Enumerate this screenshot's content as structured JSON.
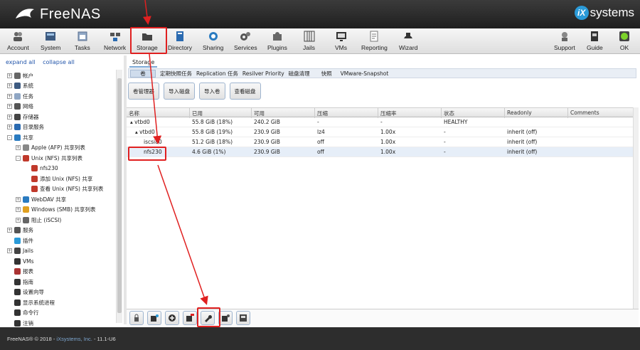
{
  "header": {
    "brand": "FreeNAS",
    "vendor_badge": "iX",
    "vendor": "systems"
  },
  "toolbar": {
    "items": [
      {
        "label": "Account",
        "icon": "users-icon"
      },
      {
        "label": "System",
        "icon": "system-icon"
      },
      {
        "label": "Tasks",
        "icon": "calendar-icon"
      },
      {
        "label": "Network",
        "icon": "network-icon"
      },
      {
        "label": "Storage",
        "icon": "folder-icon"
      },
      {
        "label": "Directory",
        "icon": "book-icon"
      },
      {
        "label": "Sharing",
        "icon": "share-icon"
      },
      {
        "label": "Services",
        "icon": "gears-icon"
      },
      {
        "label": "Plugins",
        "icon": "puzzle-icon"
      },
      {
        "label": "Jails",
        "icon": "jail-icon"
      },
      {
        "label": "VMs",
        "icon": "monitor-icon"
      },
      {
        "label": "Reporting",
        "icon": "report-icon"
      },
      {
        "label": "Wizard",
        "icon": "hat-icon"
      }
    ],
    "right_items": [
      {
        "label": "Support",
        "icon": "support-icon"
      },
      {
        "label": "Guide",
        "icon": "guide-icon"
      },
      {
        "label": "OK",
        "icon": "ok-icon"
      }
    ]
  },
  "left": {
    "expand_all": "expand all",
    "collapse_all": "collapse all",
    "tree": [
      {
        "label": "帐户",
        "toggle": "+",
        "indent": 0
      },
      {
        "label": "系统",
        "toggle": "+",
        "indent": 0
      },
      {
        "label": "任务",
        "toggle": "+",
        "indent": 0
      },
      {
        "label": "网络",
        "toggle": "+",
        "indent": 0
      },
      {
        "label": "存储器",
        "toggle": "+",
        "indent": 0
      },
      {
        "label": "目录服务",
        "toggle": "+",
        "indent": 0
      },
      {
        "label": "共享",
        "toggle": "-",
        "indent": 0
      },
      {
        "label": "Apple (AFP) 共享列表",
        "toggle": "+",
        "indent": 1
      },
      {
        "label": "Unix (NFS) 共享列表",
        "toggle": "-",
        "indent": 1
      },
      {
        "label": "nfs230",
        "toggle": "",
        "indent": 2
      },
      {
        "label": "添加 Unix (NFS) 共享",
        "toggle": "",
        "indent": 2
      },
      {
        "label": "查看 Unix (NFS) 共享列表",
        "toggle": "",
        "indent": 2
      },
      {
        "label": "WebDAV 共享",
        "toggle": "+",
        "indent": 1
      },
      {
        "label": "Windows (SMB) 共享列表",
        "toggle": "+",
        "indent": 1
      },
      {
        "label": "阻止 (iSCSI)",
        "toggle": "+",
        "indent": 1
      },
      {
        "label": "服务",
        "toggle": "+",
        "indent": 0
      },
      {
        "label": "插件",
        "toggle": "",
        "indent": 0
      },
      {
        "label": "Jails",
        "toggle": "+",
        "indent": 0
      },
      {
        "label": "VMs",
        "toggle": "",
        "indent": 0
      },
      {
        "label": "报表",
        "toggle": "",
        "indent": 0
      },
      {
        "label": "指南",
        "toggle": "",
        "indent": 0
      },
      {
        "label": "设置向导",
        "toggle": "",
        "indent": 0
      },
      {
        "label": "显示系统进程",
        "toggle": "",
        "indent": 0
      },
      {
        "label": "命令行",
        "toggle": "",
        "indent": 0
      },
      {
        "label": "注销",
        "toggle": "",
        "indent": 0
      }
    ]
  },
  "main": {
    "title": "Storage",
    "subtabs": [
      "卷",
      "定期快照任务",
      "Replication 任务",
      "Resilver Priority",
      "磁盘清理",
      "快照",
      "VMware-Snapshot"
    ],
    "buttons": [
      "卷管理器",
      "导入磁盘",
      "导入卷",
      "查看磁盘"
    ],
    "columns": [
      "名称",
      "已用",
      "可用",
      "压缩",
      "压缩率",
      "状态",
      "Readonly",
      "Comments"
    ],
    "rows": [
      {
        "name": "▴ vtbd0",
        "used": "55.8 GiB (18%)",
        "avail": "240.2 GiB",
        "comp": "-",
        "ratio": "-",
        "status": "HEALTHY",
        "ro": "",
        "comments": ""
      },
      {
        "name": "▴ vtbd0",
        "used": "55.8 GiB (19%)",
        "avail": "230.9 GiB",
        "comp": "lz4",
        "ratio": "1.00x",
        "status": "-",
        "ro": "inherit (off)",
        "comments": ""
      },
      {
        "name": "iscsi80",
        "used": "51.2 GiB (18%)",
        "avail": "230.9 GiB",
        "comp": "off",
        "ratio": "1.00x",
        "status": "-",
        "ro": "inherit (off)",
        "comments": ""
      },
      {
        "name": "nfs230",
        "used": "4.6 GiB (1%)",
        "avail": "230.9 GiB",
        "comp": "off",
        "ratio": "1.00x",
        "status": "-",
        "ro": "inherit (off)",
        "comments": ""
      }
    ]
  },
  "footer": {
    "copyright": "FreeNAS® © 2018 - ",
    "company": "iXsystems, Inc.",
    "version": " - 11.1-U6"
  },
  "colors": {
    "accent": "#2a9ad8",
    "annotation": "#e02020",
    "header_bg": "#2b2b2b",
    "selected_row": "#e6eef8"
  }
}
